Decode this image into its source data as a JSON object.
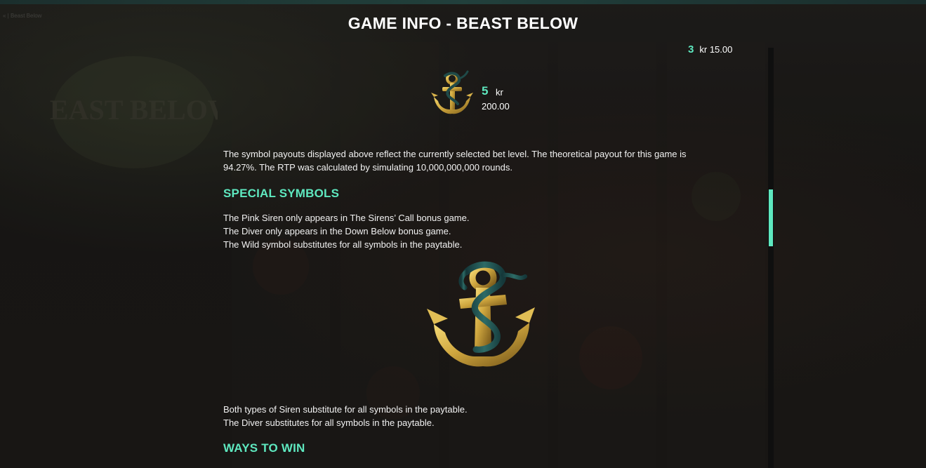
{
  "header": {
    "title": "GAME INFO - BEAST BELOW",
    "corner_crumb": "« | Beast Below"
  },
  "background": {
    "logo_text": "BEAST BELOW"
  },
  "paytable": {
    "cut_row": {
      "count": "3",
      "currency": "kr",
      "value": "15.00"
    },
    "row": {
      "symbol_icon": "anchor-icon",
      "count": "5",
      "currency": "kr",
      "value": "200.00"
    }
  },
  "rtp_note": {
    "line1": "The symbol payouts displayed above reflect the currently selected bet level. The theoretical payout for this game is",
    "line2": "94.27%. The RTP was calculated by simulating 10,000,000,000 rounds."
  },
  "special_symbols": {
    "heading": "SPECIAL SYMBOLS",
    "lines": [
      "The Pink Siren only appears in The Sirens’ Call bonus game.",
      "The Diver only appears in the Down Below bonus game.",
      "The Wild symbol substitutes for all symbols in the paytable."
    ],
    "wild_icon": "anchor-wild-icon",
    "substitute_lines": [
      "Both types of Siren substitute for all symbols in the paytable.",
      "The Diver substitutes for all symbols in the paytable."
    ]
  },
  "ways_to_win": {
    "heading": "WAYS TO WIN"
  },
  "colors": {
    "accent": "#5ee8bf",
    "text": "#ffffff",
    "background": "#1b1917",
    "scroll_track": "#0f0f0f"
  },
  "scroll": {
    "position_fraction": 0.39
  }
}
